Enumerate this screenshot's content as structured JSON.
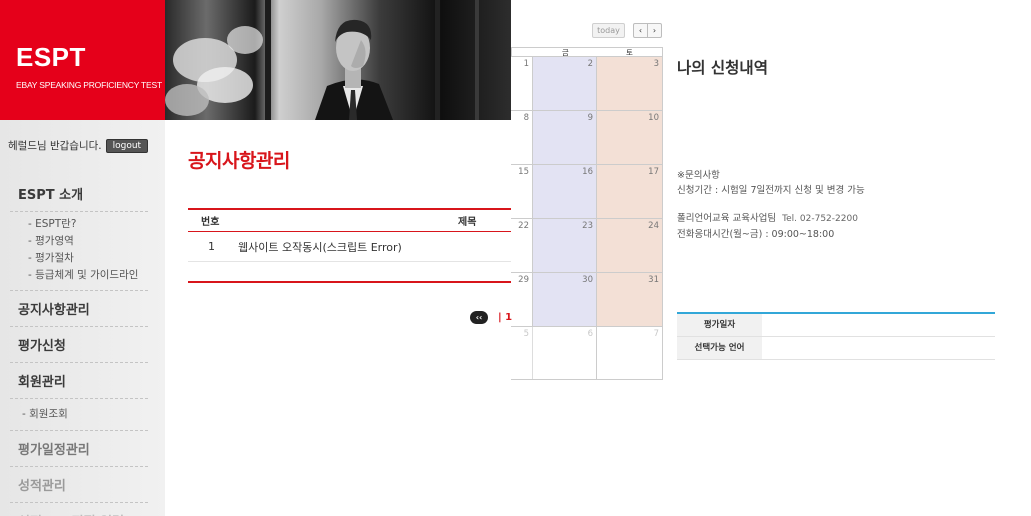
{
  "brand": {
    "name": "ESPT",
    "subtitle": "EBAY SPEAKING PROFICIENCY TEST",
    "color": "#e5001a"
  },
  "user": {
    "greeting": "헤럴드님 반갑습니다.",
    "logout_label": "logout"
  },
  "sidebar": {
    "items": [
      {
        "label": "ESPT 소개",
        "children": [
          "- ESPT란?",
          "- 평가영역",
          "- 평가절차",
          "- 등급체계 및 가이드라인"
        ]
      },
      {
        "label": "공지사항관리"
      },
      {
        "label": "평가신청"
      },
      {
        "label": "회원관리",
        "children": [
          "- 회원조회"
        ]
      },
      {
        "label": "평가일정관리"
      },
      {
        "label": "성적관리"
      },
      {
        "label": "성적 DB 직접 입력"
      }
    ]
  },
  "notice": {
    "title": "공지사항관리",
    "columns": [
      "번호",
      "제목"
    ],
    "rows": [
      {
        "no": "1",
        "title": "웹사이트 오작동시(스크립트 Error)"
      }
    ],
    "pager": {
      "first_label": "‹‹",
      "current": "| 1"
    }
  },
  "calendar": {
    "today_label": "today",
    "prev_label": "‹",
    "next_label": "›",
    "day_headers": [
      "",
      "금",
      "토"
    ],
    "weeks": [
      [
        "1",
        "2",
        "3"
      ],
      [
        "8",
        "9",
        "10"
      ],
      [
        "15",
        "16",
        "17"
      ],
      [
        "22",
        "23",
        "24"
      ],
      [
        "29",
        "30",
        "31"
      ],
      [
        "5",
        "6",
        "7"
      ]
    ],
    "colors": {
      "friday": "#e3e3f3",
      "saturday": "#f3e0d6"
    }
  },
  "my_application": {
    "title": "나의 신청내역",
    "inquiry_heading": "※문의사항",
    "inquiry_period": "신청기간 : 시험일 7일전까지 신청 및 변경 가능",
    "org": "폴리언어교육 교육사업팀",
    "tel": "Tel. 02-752-2200",
    "hours": "전화응대시간(월~금) : 09:00~18:00",
    "fields": [
      {
        "label": "평가일자",
        "value": ""
      },
      {
        "label": "선택가능 언어",
        "value": ""
      }
    ],
    "accent": "#32a7d8"
  }
}
